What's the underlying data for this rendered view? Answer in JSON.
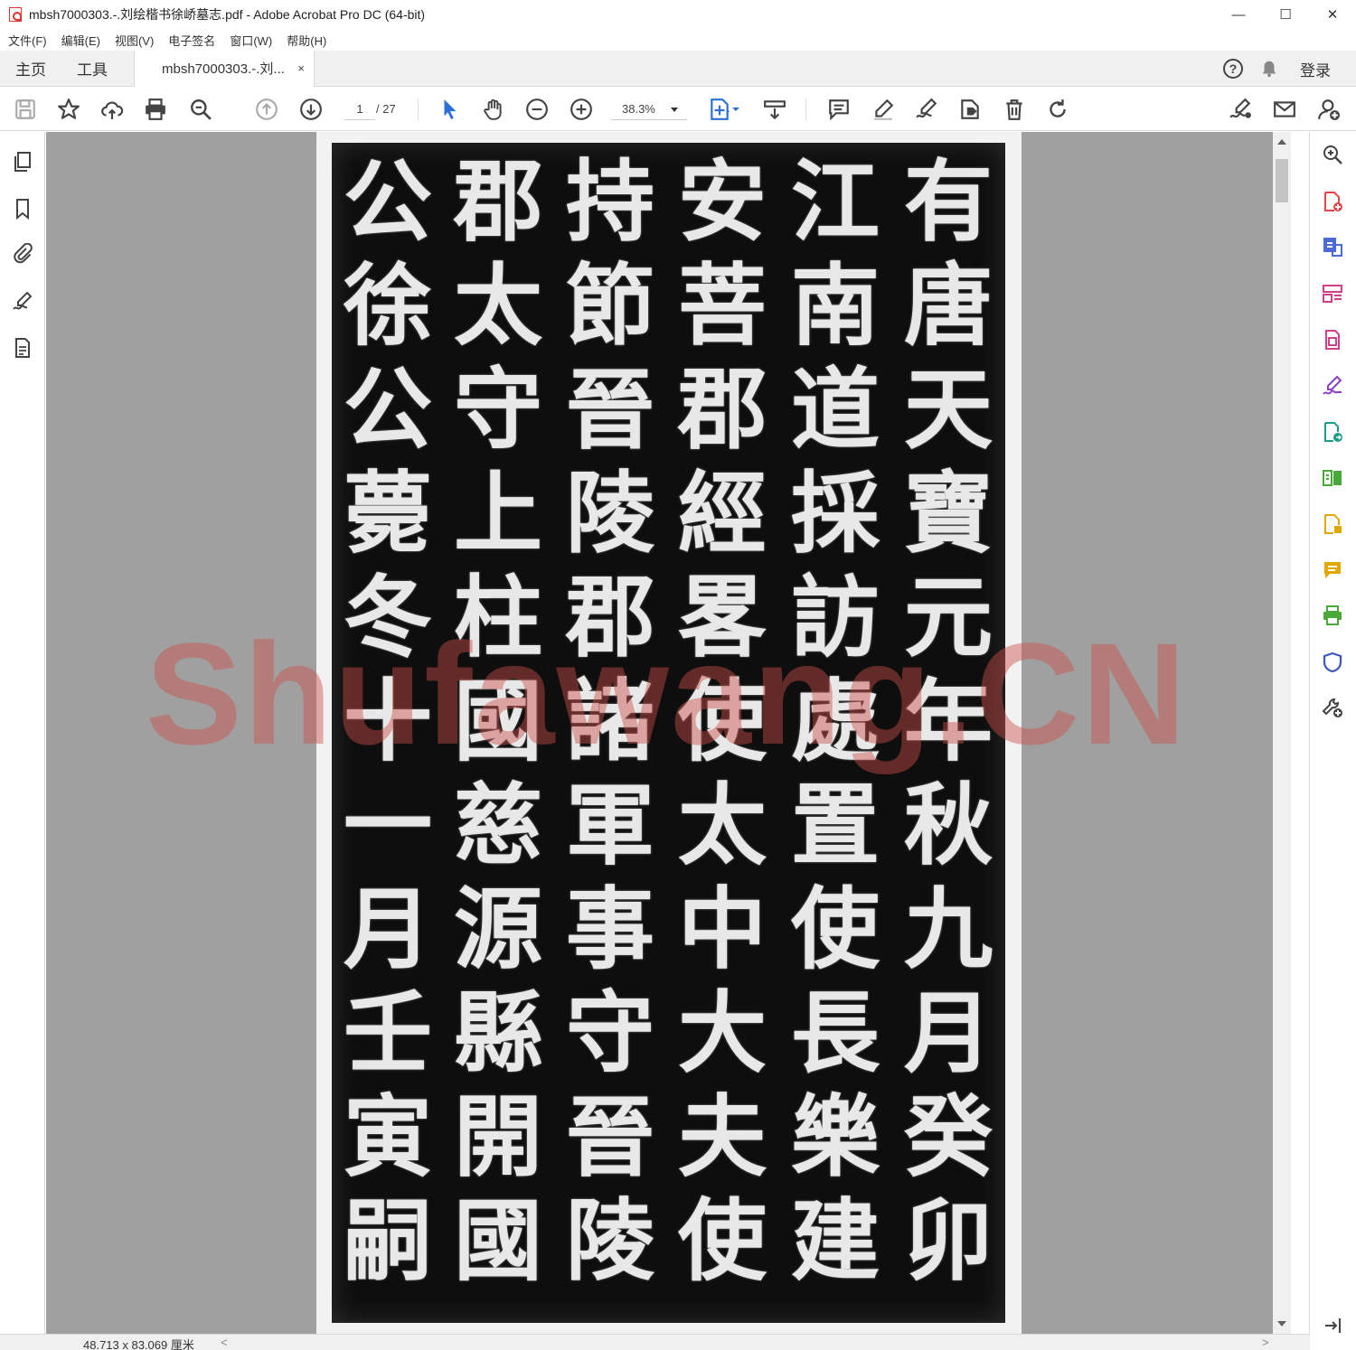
{
  "window": {
    "title": "mbsh7000303.-.刘绘楷书徐峤墓志.pdf - Adobe Acrobat Pro DC (64-bit)",
    "controls": {
      "minimize": "—",
      "maximize": "☐",
      "close": "✕"
    }
  },
  "menu": {
    "items": [
      "文件(F)",
      "编辑(E)",
      "视图(V)",
      "电子签名",
      "窗口(W)",
      "帮助(H)"
    ]
  },
  "tabs": {
    "home": "主页",
    "tools": "工具",
    "document": "mbsh7000303.-.刘...",
    "close": "×",
    "login": "登录"
  },
  "toolbar": {
    "current_page": "1",
    "total_pages": "/ 27",
    "zoom": "38.3%"
  },
  "document": {
    "columns": [
      "有唐天寶元年秋九月癸卯",
      "江南道採訪處置使長樂建",
      "安菩郡經畧使太中大夫使",
      "持節晉陵郡諸軍事守晉陵",
      "郡太守上柱國慈源縣開國",
      "公徐公薨冬十一月壬寅嗣"
    ],
    "watermark": "Shufawang.CN"
  },
  "status": {
    "dimensions": "48.713 x 83.069 厘米",
    "scroll_left": "<",
    "scroll_right": ">"
  },
  "colors": {
    "accent_blue": "#2b6fd6",
    "tool_red": "#e0464b",
    "tool_blue": "#4b6bd6",
    "tool_pink": "#d0408a",
    "tool_purple": "#8a3fc4",
    "tool_teal": "#1e9a8a",
    "tool_green": "#4aa83a",
    "tool_yellow": "#e0a800",
    "tool_navy": "#3a58b8",
    "watermark": "#cd5046"
  }
}
